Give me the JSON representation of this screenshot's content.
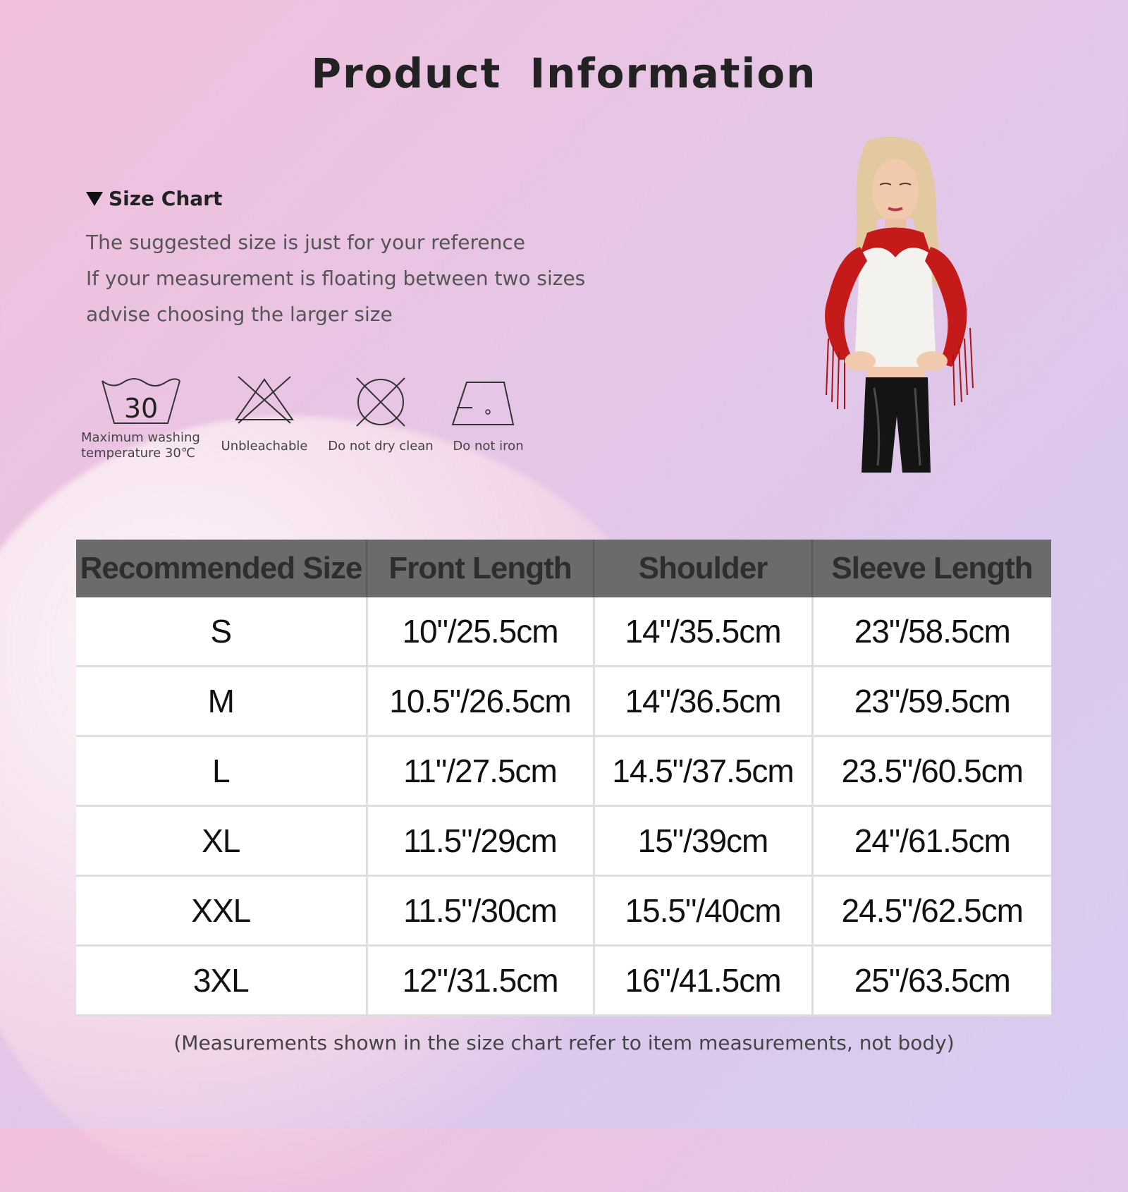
{
  "title": "Product  Information",
  "size_chart": {
    "heading": "Size Chart",
    "notes": [
      "The suggested size is just for your reference",
      "If your measurement is floating between two sizes",
      "advise choosing the larger size"
    ]
  },
  "care": [
    {
      "icon": "wash-30-icon",
      "symbol_text": "30",
      "label_lines": [
        "Maximum washing",
        "temperature 30℃"
      ]
    },
    {
      "icon": "no-bleach-icon",
      "label_lines": [
        "Unbleachable"
      ]
    },
    {
      "icon": "no-dry-clean-icon",
      "label_lines": [
        "Do not dry clean"
      ]
    },
    {
      "icon": "no-iron-icon",
      "label_lines": [
        "Do not iron"
      ]
    }
  ],
  "table": {
    "headers": [
      "Recommended Size",
      "Front Length",
      "Shoulder",
      "Sleeve Length"
    ],
    "rows": [
      [
        "S",
        "10\"/25.5cm",
        "14\"/35.5cm",
        "23\"/58.5cm"
      ],
      [
        "M",
        "10.5\"/26.5cm",
        "14\"/36.5cm",
        "23\"/59.5cm"
      ],
      [
        "L",
        "11\"/27.5cm",
        "14.5\"/37.5cm",
        "23.5\"/60.5cm"
      ],
      [
        "XL",
        "11.5\"/29cm",
        "15\"/39cm",
        "24\"/61.5cm"
      ],
      [
        "XXL",
        "11.5\"/30cm",
        "15.5\"/40cm",
        "24.5\"/62.5cm"
      ],
      [
        "3XL",
        "12\"/31.5cm",
        "16\"/41.5cm",
        "25\"/63.5cm"
      ]
    ]
  },
  "footer_note": "(Measurements shown in the size chart refer to item measurements, not body)",
  "colors": {
    "header_bg": "#6b6b6b",
    "garment_red": "#c41a1a"
  }
}
